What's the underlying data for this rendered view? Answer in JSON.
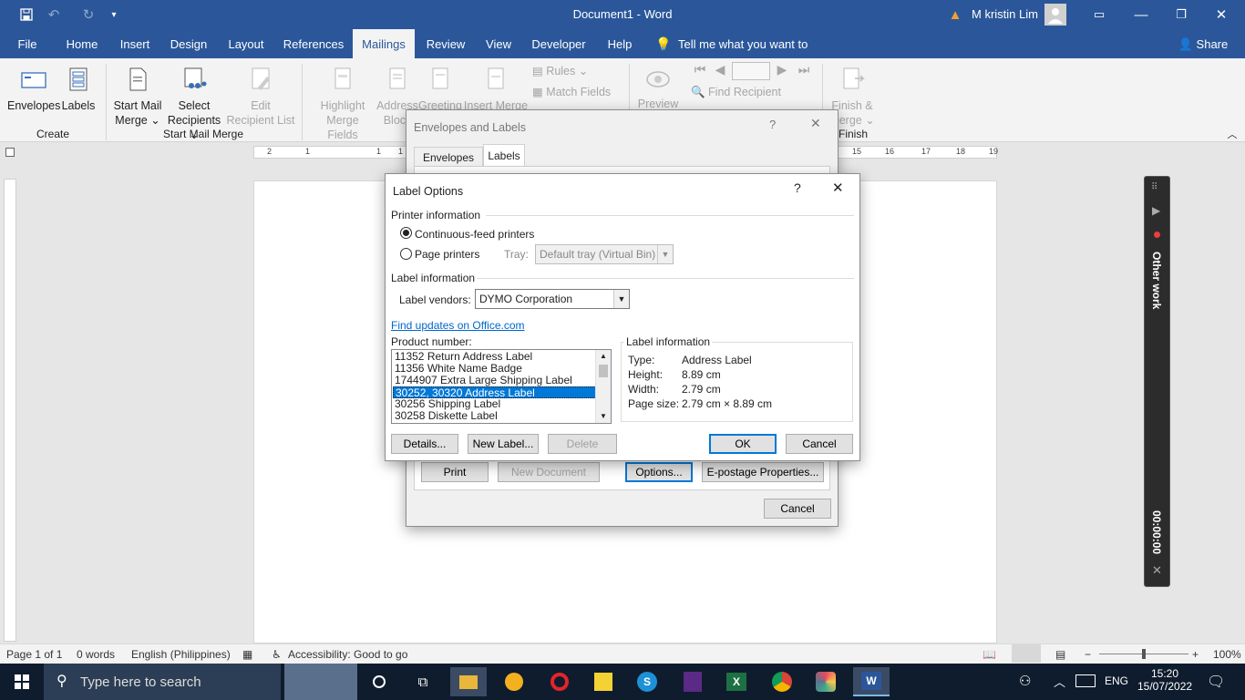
{
  "window": {
    "title": "Document1  -  Word",
    "user": "M kristin Lim"
  },
  "tabs": [
    "File",
    "Home",
    "Insert",
    "Design",
    "Layout",
    "References",
    "Mailings",
    "Review",
    "View",
    "Developer",
    "Help"
  ],
  "active_tab": "Mailings",
  "tell_me": "Tell me what you want to do",
  "share": "Share",
  "ribbon": {
    "envelopes": "Envelopes",
    "labels": "Labels",
    "create": "Create",
    "start_mail_merge": [
      "Start Mail",
      "Merge ⌄"
    ],
    "select_recipients": [
      "Select",
      "Recipients ⌄"
    ],
    "edit_recipient_list": [
      "Edit",
      "Recipient List"
    ],
    "start_group": "Start Mail Merge",
    "highlight": [
      "Highlight",
      "Merge Fields"
    ],
    "address_block": [
      "Address",
      "Block"
    ],
    "greeting": [
      "Greeting"
    ],
    "insert_merge": [
      "Insert Merge"
    ],
    "rules": "Rules ⌄",
    "match_fields": "Match Fields",
    "preview": "Preview",
    "find_recipient": "Find Recipient",
    "finish_merge": [
      "Finish &",
      "Merge ⌄"
    ],
    "finish_group": "Finish"
  },
  "ruler_marks": [
    "2",
    "1",
    "1",
    "1",
    "2",
    "15",
    "16",
    "17",
    "18",
    "19"
  ],
  "env_dialog": {
    "title": "Envelopes and Labels",
    "help": "?",
    "close": "✕",
    "tabs": [
      "Envelopes",
      "Labels"
    ],
    "buttons": {
      "print": "Print",
      "new_document": "New Document",
      "options": "Options...",
      "epostage": "E-postage Properties...",
      "cancel": "Cancel"
    }
  },
  "label_options": {
    "title": "Label Options",
    "help": "?",
    "close": "✕",
    "printer_info": "Printer information",
    "continuous": "Continuous-feed printers",
    "page_printers": "Page printers",
    "tray_label": "Tray:",
    "tray_value": "Default tray (Virtual Bin)",
    "label_info": "Label information",
    "vendors_label": "Label vendors:",
    "vendors_value": "DYMO Corporation",
    "find_updates": "Find updates on Office.com",
    "product_number": "Product number:",
    "products": [
      "11352 Return Address Label",
      "11356 White Name Badge",
      "1744907 Extra Large Shipping Label",
      "30252, 30320 Address Label",
      "30256 Shipping Label",
      "30258 Diskette Label"
    ],
    "selected_index": 3,
    "info_title": "Label information",
    "info": [
      {
        "k": "Type:",
        "v": "Address Label"
      },
      {
        "k": "Height:",
        "v": "8.89 cm"
      },
      {
        "k": "Width:",
        "v": "2.79 cm"
      },
      {
        "k": "Page size:",
        "v": "2.79 cm × 8.89 cm"
      }
    ],
    "buttons": {
      "details": "Details...",
      "new_label": "New Label...",
      "delete": "Delete",
      "ok": "OK",
      "cancel": "Cancel"
    }
  },
  "recorder": {
    "label": "Other work",
    "time": "00:00:00"
  },
  "status": {
    "page": "Page 1 of 1",
    "words": "0 words",
    "language": "English (Philippines)",
    "accessibility": "Accessibility: Good to go",
    "zoom": "100%"
  },
  "taskbar": {
    "search": "Type here to search",
    "lang": "ENG",
    "time": "15:20",
    "date": "15/07/2022"
  },
  "colors": {
    "word_blue": "#2b579a",
    "accent": "#0078d7",
    "taskbar": "#0f1c2e"
  }
}
